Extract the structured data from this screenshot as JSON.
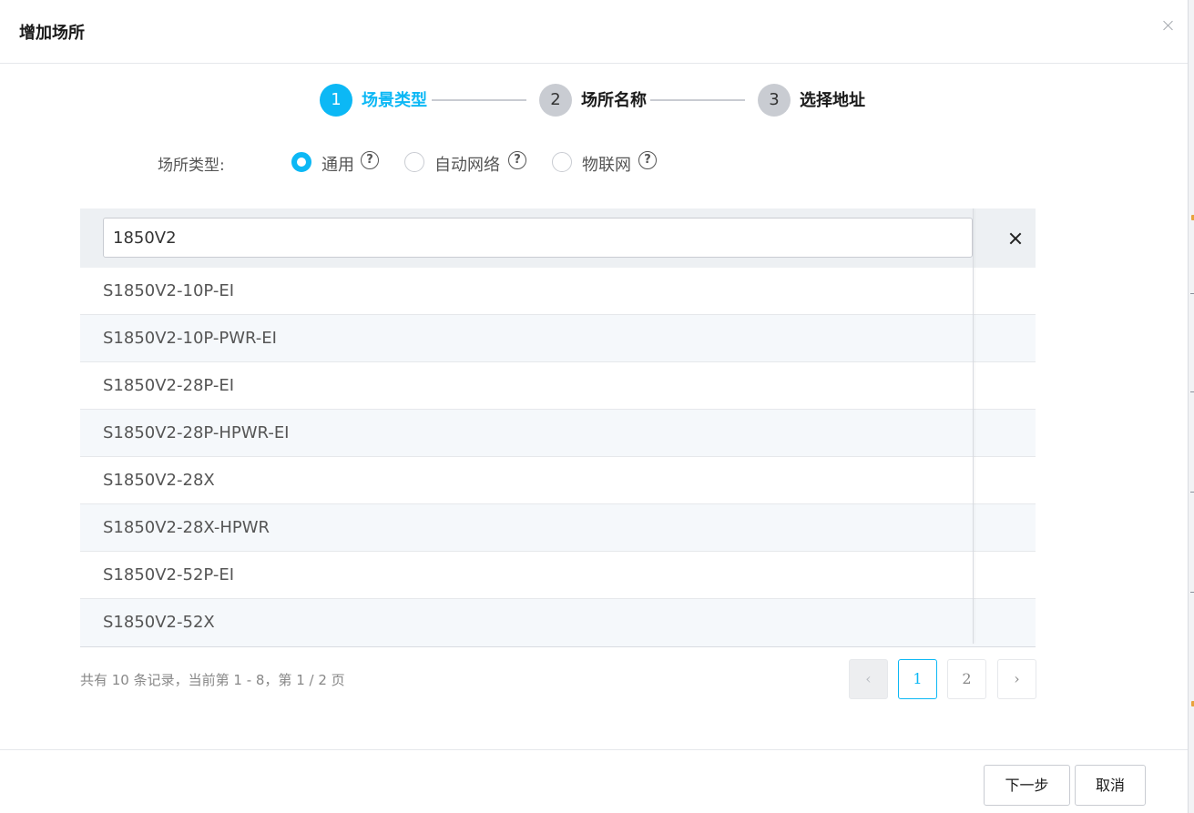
{
  "dialog": {
    "title": "增加场所",
    "close_icon": "close-icon"
  },
  "steps": [
    {
      "number": "1",
      "label": "场景类型",
      "active": true
    },
    {
      "number": "2",
      "label": "场所名称",
      "active": false
    },
    {
      "number": "3",
      "label": "选择地址",
      "active": false
    }
  ],
  "site_type": {
    "label": "场所类型:",
    "options": [
      {
        "label": "通用",
        "checked": true,
        "help": "?"
      },
      {
        "label": "自动网络",
        "checked": false,
        "help": "?"
      },
      {
        "label": "物联网",
        "checked": false,
        "help": "?"
      }
    ]
  },
  "search": {
    "value": "1850V2"
  },
  "models": [
    "S1850V2-10P-EI",
    "S1850V2-10P-PWR-EI",
    "S1850V2-28P-EI",
    "S1850V2-28P-HPWR-EI",
    "S1850V2-28X",
    "S1850V2-28X-HPWR",
    "S1850V2-52P-EI",
    "S1850V2-52X"
  ],
  "pagination": {
    "info": "共有 10 条记录，当前第 1 - 8，第 1 / 2 页",
    "prev": "‹",
    "next": "›",
    "pages": [
      "1",
      "2"
    ],
    "current_page": "1"
  },
  "footer": {
    "next_label": "下一步",
    "cancel_label": "取消"
  },
  "colors": {
    "accent": "#0cb8f5",
    "inactive_step": "#c9ccd2"
  }
}
